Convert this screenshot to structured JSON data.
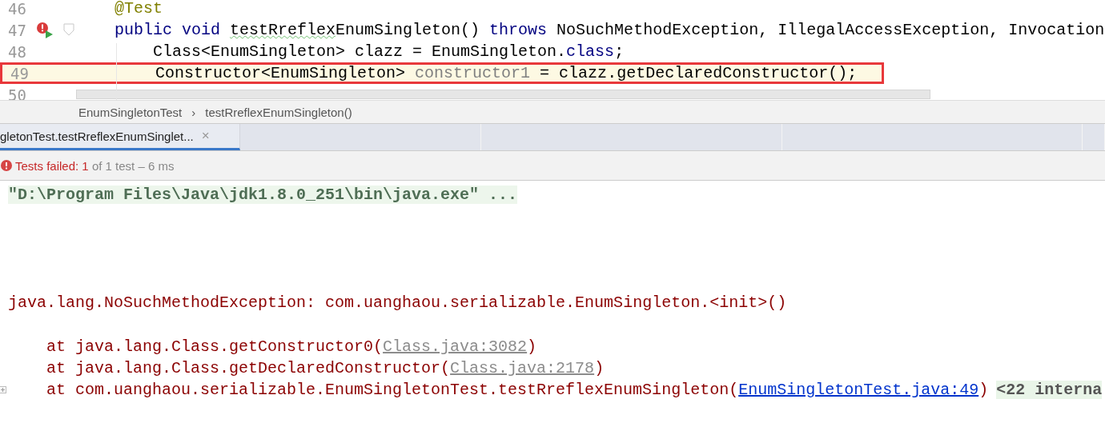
{
  "editor": {
    "lines": [
      {
        "number": "46",
        "current": false,
        "boxed": false,
        "gutter_icons": false,
        "tokens": [
          {
            "kind": "annotation",
            "text": "    @Test"
          }
        ]
      },
      {
        "number": "47",
        "current": false,
        "boxed": false,
        "gutter_icons": true,
        "tokens": [
          {
            "kind": "keyword",
            "text": "    public void "
          },
          {
            "kind": "typo",
            "text": "testRreflex"
          },
          {
            "kind": "plain",
            "text": "EnumSingleton() "
          },
          {
            "kind": "keyword",
            "text": "throws "
          },
          {
            "kind": "plain",
            "text": "NoSuchMethodException, IllegalAccessException, Invocation"
          }
        ]
      },
      {
        "number": "48",
        "current": false,
        "boxed": false,
        "gutter_icons": false,
        "tokens": [
          {
            "kind": "plain",
            "text": "        Class<EnumSingleton> clazz = EnumSingleton."
          },
          {
            "kind": "keyword",
            "text": "class"
          },
          {
            "kind": "plain",
            "text": ";"
          }
        ]
      },
      {
        "number": "49",
        "current": true,
        "boxed": true,
        "gutter_icons": false,
        "tokens": [
          {
            "kind": "plain",
            "text": "        Constructor<EnumSingleton> "
          },
          {
            "kind": "unused",
            "text": "constructor1"
          },
          {
            "kind": "plain",
            "text": " = clazz.getDeclaredConstructor();"
          }
        ]
      },
      {
        "number": "50",
        "current": false,
        "boxed": false,
        "gutter_icons": false
      }
    ]
  },
  "breadcrumbs": {
    "items": [
      "EnumSingletonTest",
      "testRreflexEnumSingleton()"
    ],
    "separator": "›"
  },
  "tabs": [
    {
      "label": "gletonTest.testRreflexEnumSinglet...",
      "close": "×",
      "selected": true
    }
  ],
  "status": {
    "label": "Tests failed:",
    "failed": "1",
    "summary": "of 1 test – 6 ms"
  },
  "console": [
    {
      "kind": "command",
      "text": "\"D:\\Program Files\\Java\\jdk1.8.0_251\\bin\\java.exe\" ..."
    },
    {
      "kind": "exception",
      "text": "java.lang.NoSuchMethodException: com.uanghaou.serializable.EnumSingleton.<init>()"
    },
    {
      "kind": "frame",
      "prefix": "at java.lang.Class.getConstructor0(",
      "link": "Class.java:3082",
      "dimmed": true,
      "suffix": ")"
    },
    {
      "kind": "frame",
      "prefix": "at java.lang.Class.getDeclaredConstructor(",
      "link": "Class.java:2178",
      "dimmed": true,
      "suffix": ")"
    },
    {
      "kind": "frame",
      "prefix": "at com.uanghaou.serializable.EnumSingletonTest.testRreflexEnumSingleton(",
      "link": "EnumSingletonTest.java:49",
      "dimmed": false,
      "suffix": ")",
      "folded": "<22 interna"
    }
  ]
}
